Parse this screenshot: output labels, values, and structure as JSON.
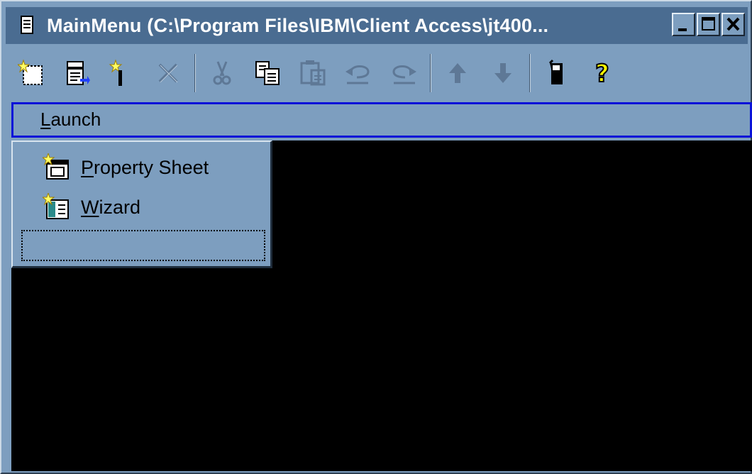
{
  "window": {
    "title": "MainMenu (C:\\Program Files\\IBM\\Client Access\\jt400..."
  },
  "colors": {
    "window_bg": "#7d9ebf",
    "titlebar_bg": "#4a6c91",
    "menubar_focus_border": "#0a12d8",
    "client_bg": "#000000"
  },
  "window_buttons": [
    "minimize-icon",
    "maximize-icon",
    "close-icon"
  ],
  "toolbar": {
    "buttons": [
      {
        "icon": "new-icon",
        "enabled": true
      },
      {
        "icon": "properties-icon",
        "enabled": true
      },
      {
        "icon": "wand-icon",
        "enabled": true
      },
      {
        "icon": "delete-icon",
        "enabled": false
      },
      {
        "icon": "cut-icon",
        "enabled": false
      },
      {
        "icon": "copy-icon",
        "enabled": true
      },
      {
        "icon": "paste-icon",
        "enabled": false
      },
      {
        "icon": "undo-icon",
        "enabled": false
      },
      {
        "icon": "redo-icon",
        "enabled": false
      },
      {
        "icon": "move-up-icon",
        "enabled": false
      },
      {
        "icon": "move-down-icon",
        "enabled": false
      },
      {
        "icon": "save-icon",
        "enabled": true
      },
      {
        "icon": "help-icon",
        "enabled": true
      }
    ]
  },
  "menubar": {
    "launch": {
      "mnemonic": "L",
      "rest": "aunch"
    }
  },
  "dropdown": {
    "items": [
      {
        "mnemonic": "P",
        "rest": "roperty Sheet",
        "icon": "property-sheet-icon"
      },
      {
        "mnemonic": "W",
        "rest": "izard",
        "icon": "wizard-icon"
      }
    ]
  }
}
